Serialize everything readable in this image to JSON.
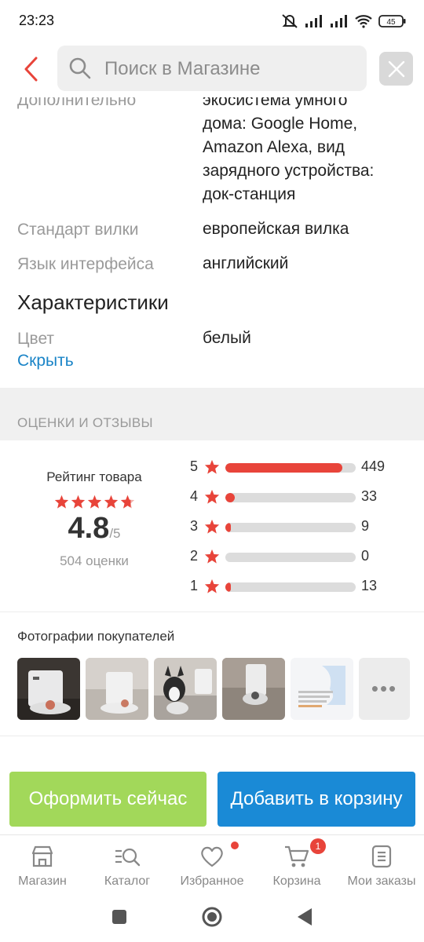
{
  "status": {
    "time": "23:23",
    "battery": "45"
  },
  "search": {
    "placeholder": "Поиск в Магазине"
  },
  "specs": {
    "cut_label": "Дополнительно",
    "cut_value_line": "экосистема умного",
    "extra_lines": [
      "дома: Google Home,",
      "Amazon Alexa, вид",
      "зарядного устройства:",
      "док-станция"
    ],
    "rows": [
      {
        "label": "Стандарт вилки",
        "value": "европейская вилка"
      },
      {
        "label": "Язык интерфейса",
        "value": "английский"
      }
    ],
    "section_title": "Характеристики",
    "color_label": "Цвет",
    "color_value": "белый",
    "hide_link": "Скрыть"
  },
  "reviews": {
    "header": "ОЦЕНКИ И ОТЗЫВЫ",
    "rating_title": "Рейтинг товара",
    "score": "4.8",
    "score_max": "/5",
    "count": "504 оценки",
    "breakdown": [
      {
        "stars": "5",
        "count": "449",
        "fraction": 0.9
      },
      {
        "stars": "4",
        "count": "33",
        "fraction": 0.07
      },
      {
        "stars": "3",
        "count": "9",
        "fraction": 0.02
      },
      {
        "stars": "2",
        "count": "0",
        "fraction": 0.0
      },
      {
        "stars": "1",
        "count": "13",
        "fraction": 0.026
      }
    ],
    "photos_title": "Фотографии покупателей",
    "more": "•••"
  },
  "actions": {
    "buy": "Оформить сейчас",
    "add_to_cart": "Добавить в корзину"
  },
  "tabs": [
    {
      "label": "Магазин",
      "icon": "store-icon"
    },
    {
      "label": "Каталог",
      "icon": "catalog-search-icon"
    },
    {
      "label": "Избранное",
      "icon": "heart-icon"
    },
    {
      "label": "Корзина",
      "icon": "cart-icon",
      "badge": "1"
    },
    {
      "label": "Мои заказы",
      "icon": "orders-icon"
    }
  ],
  "colors": {
    "accent": "#e8443a",
    "buy": "#a2d85a",
    "cart": "#1a8ad6",
    "link": "#1a84c7"
  }
}
